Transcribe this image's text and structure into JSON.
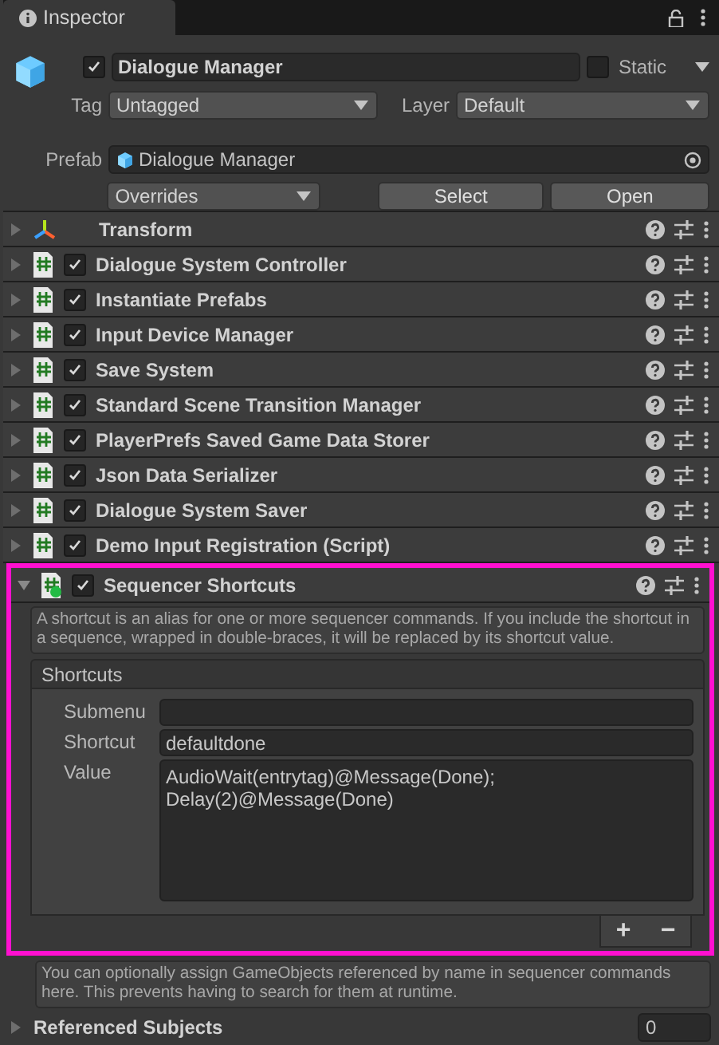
{
  "panel_tab": {
    "label": "Inspector"
  },
  "game_object": {
    "active": true,
    "name": "Dialogue Manager",
    "static": false,
    "static_label": "Static",
    "tag_label": "Tag",
    "tag": "Untagged",
    "layer_label": "Layer",
    "layer": "Default",
    "prefab_label": "Prefab",
    "prefab": "Dialogue Manager",
    "overrides": "Overrides",
    "buttons": [
      "Select",
      "Open"
    ]
  },
  "components": [
    {
      "kind": "transform",
      "name": "Transform",
      "expanded": false,
      "highlighted": false
    },
    {
      "kind": "script",
      "name": "Dialogue System Controller",
      "enabled": true,
      "expanded": false,
      "highlighted": false
    },
    {
      "kind": "script",
      "name": "Instantiate Prefabs",
      "enabled": true,
      "expanded": false,
      "highlighted": false
    },
    {
      "kind": "script",
      "name": "Input Device Manager",
      "enabled": true,
      "expanded": false,
      "highlighted": false
    },
    {
      "kind": "script",
      "name": "Save System",
      "enabled": true,
      "expanded": false,
      "highlighted": false
    },
    {
      "kind": "script",
      "name": "Standard Scene Transition Manager",
      "enabled": true,
      "expanded": false,
      "highlighted": false
    },
    {
      "kind": "script",
      "name": "PlayerPrefs Saved Game Data Storer",
      "enabled": true,
      "expanded": false,
      "highlighted": false
    },
    {
      "kind": "script",
      "name": "Json Data Serializer",
      "enabled": true,
      "expanded": false,
      "highlighted": false
    },
    {
      "kind": "script",
      "name": "Dialogue System Saver",
      "enabled": true,
      "expanded": false,
      "highlighted": false
    },
    {
      "kind": "script",
      "name": "Demo Input Registration (Script)",
      "enabled": true,
      "expanded": false,
      "highlighted": false
    },
    {
      "kind": "sequencer",
      "name": "Sequencer Shortcuts",
      "enabled": true,
      "expanded": true,
      "highlighted": true
    }
  ],
  "sequencer": {
    "help": "A shortcut is an alias for one or more sequencer commands. If you include the shortcut in a sequence, wrapped in double-braces, it will be replaced by its shortcut value.",
    "list_title": "Shortcuts",
    "fields": [
      {
        "kind": "line",
        "label": "Submenu"
      },
      {
        "kind": "line",
        "label": "Shortcut",
        "value": "defaultdone"
      },
      {
        "kind": "area",
        "label": "Value",
        "value": "AudioWait(entrytag)@Message(Done);\nDelay(2)@Message(Done)"
      }
    ],
    "list_buttons": [
      "+",
      "−"
    ]
  },
  "subjects": {
    "help": "You can optionally assign GameObjects referenced by name in sequencer commands here. This prevents having to search for them at runtime.",
    "label": "Referenced Subjects",
    "count": "0",
    "expanded": false
  }
}
